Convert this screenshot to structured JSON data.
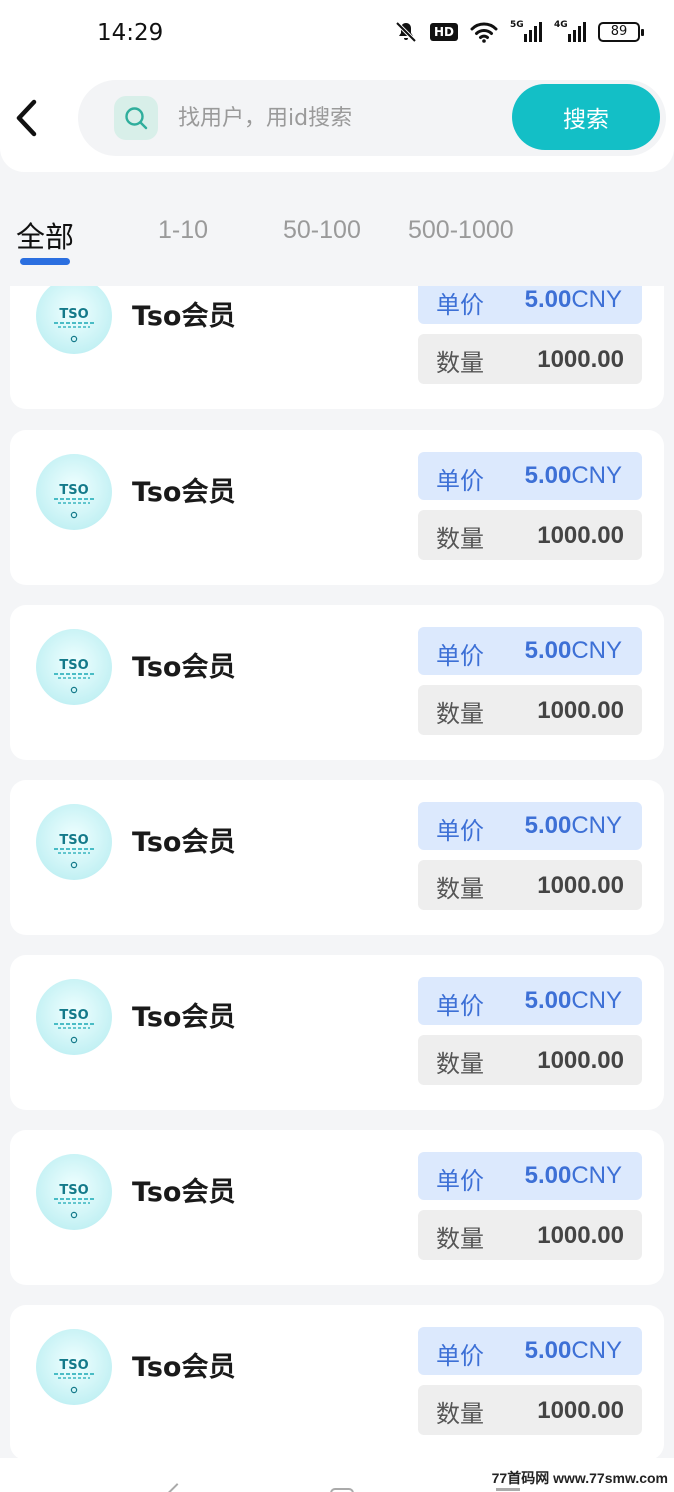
{
  "status_bar": {
    "time": "14:29",
    "hd": "HD",
    "net1": "5G",
    "net2": "4G",
    "battery": "89",
    "icons": [
      "mute-icon",
      "hd-icon",
      "wifi-icon",
      "signal-5g-icon",
      "signal-4g-icon",
      "battery-icon"
    ]
  },
  "search": {
    "placeholder": "找用户，用id搜索",
    "button_label": "搜索"
  },
  "tabs": [
    {
      "label": "全部",
      "active": true
    },
    {
      "label": "1-10",
      "active": false
    },
    {
      "label": "50-100",
      "active": false
    },
    {
      "label": "500-1000",
      "active": false
    }
  ],
  "colors": {
    "accent": "#13bfc6",
    "tab_underline": "#2b6fe0",
    "price_text": "#3d70d6",
    "price_bg": "#dce9fd"
  },
  "listings": [
    {
      "name": "Tso会员",
      "avatar_text": "TSO",
      "price_label": "单价",
      "price": "5.00",
      "currency": "CNY",
      "qty_label": "数量",
      "qty": "1000.00"
    },
    {
      "name": "Tso会员",
      "avatar_text": "TSO",
      "price_label": "单价",
      "price": "5.00",
      "currency": "CNY",
      "qty_label": "数量",
      "qty": "1000.00"
    },
    {
      "name": "Tso会员",
      "avatar_text": "TSO",
      "price_label": "单价",
      "price": "5.00",
      "currency": "CNY",
      "qty_label": "数量",
      "qty": "1000.00"
    },
    {
      "name": "Tso会员",
      "avatar_text": "TSO",
      "price_label": "单价",
      "price": "5.00",
      "currency": "CNY",
      "qty_label": "数量",
      "qty": "1000.00"
    },
    {
      "name": "Tso会员",
      "avatar_text": "TSO",
      "price_label": "单价",
      "price": "5.00",
      "currency": "CNY",
      "qty_label": "数量",
      "qty": "1000.00"
    },
    {
      "name": "Tso会员",
      "avatar_text": "TSO",
      "price_label": "单价",
      "price": "5.00",
      "currency": "CNY",
      "qty_label": "数量",
      "qty": "1000.00"
    },
    {
      "name": "Tso会员",
      "avatar_text": "TSO",
      "price_label": "单价",
      "price": "5.00",
      "currency": "CNY",
      "qty_label": "数量",
      "qty": "1000.00"
    }
  ],
  "watermark": "77首码网 www.77smw.com"
}
